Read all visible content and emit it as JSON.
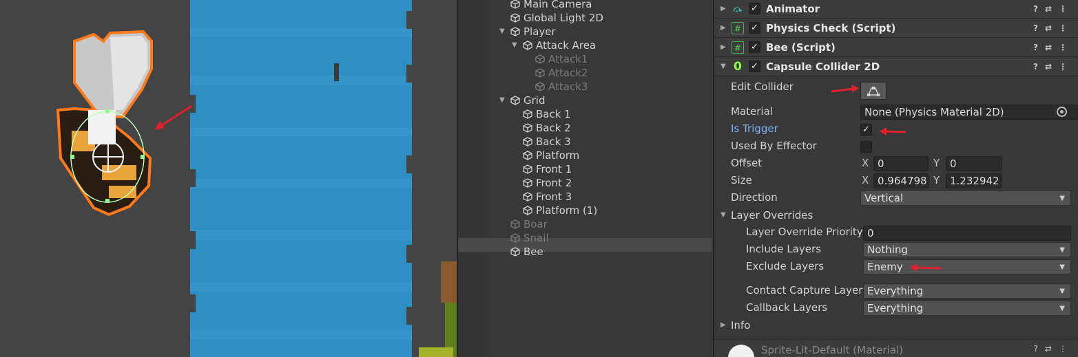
{
  "hierarchy": {
    "items": [
      {
        "label": "Main Camera",
        "depth": 1,
        "disabled": false,
        "expander": ""
      },
      {
        "label": "Global Light 2D",
        "depth": 1,
        "disabled": false,
        "expander": ""
      },
      {
        "label": "Player",
        "depth": 1,
        "disabled": false,
        "expander": "expanded"
      },
      {
        "label": "Attack Area",
        "depth": 2,
        "disabled": false,
        "expander": "expanded"
      },
      {
        "label": "Attack1",
        "depth": 3,
        "disabled": true,
        "expander": ""
      },
      {
        "label": "Attack2",
        "depth": 3,
        "disabled": true,
        "expander": ""
      },
      {
        "label": "Attack3",
        "depth": 3,
        "disabled": true,
        "expander": ""
      },
      {
        "label": "Grid",
        "depth": 1,
        "disabled": false,
        "expander": "expanded"
      },
      {
        "label": "Back 1",
        "depth": 2,
        "disabled": false,
        "expander": ""
      },
      {
        "label": "Back 2",
        "depth": 2,
        "disabled": false,
        "expander": ""
      },
      {
        "label": "Back 3",
        "depth": 2,
        "disabled": false,
        "expander": ""
      },
      {
        "label": "Platform",
        "depth": 2,
        "disabled": false,
        "expander": ""
      },
      {
        "label": "Front 1",
        "depth": 2,
        "disabled": false,
        "expander": ""
      },
      {
        "label": "Front 2",
        "depth": 2,
        "disabled": false,
        "expander": ""
      },
      {
        "label": "Front 3",
        "depth": 2,
        "disabled": false,
        "expander": ""
      },
      {
        "label": "Platform (1)",
        "depth": 2,
        "disabled": false,
        "expander": ""
      },
      {
        "label": "Boar",
        "depth": 1,
        "disabled": true,
        "expander": ""
      },
      {
        "label": "Snail",
        "depth": 1,
        "disabled": true,
        "expander": ""
      },
      {
        "label": "Bee",
        "depth": 1,
        "disabled": false,
        "expander": "",
        "selected": true
      }
    ]
  },
  "inspector": {
    "components": [
      {
        "name": "Animator",
        "icon": "animator-icon",
        "enabled": true
      },
      {
        "name": "Physics Check (Script)",
        "icon": "script-icon",
        "enabled": true
      },
      {
        "name": "Bee (Script)",
        "icon": "script-icon",
        "enabled": true
      },
      {
        "name": "Capsule Collider 2D",
        "icon": "capsule-collider-icon",
        "enabled": true
      }
    ],
    "collider": {
      "edit_collider_label": "Edit Collider",
      "material_label": "Material",
      "material_value": "None (Physics Material 2D)",
      "is_trigger_label": "Is Trigger",
      "is_trigger": true,
      "used_by_effector_label": "Used By Effector",
      "used_by_effector": false,
      "offset_label": "Offset",
      "offset_x": "0",
      "offset_y": "0",
      "size_label": "Size",
      "size_x": "0.964798",
      "size_y": "1.232942",
      "direction_label": "Direction",
      "direction_value": "Vertical",
      "layer_overrides_label": "Layer Overrides",
      "layer_override_priority_label": "Layer Override Priority",
      "layer_override_priority_value": "0",
      "include_layers_label": "Include Layers",
      "include_layers_value": "Nothing",
      "exclude_layers_label": "Exclude Layers",
      "exclude_layers_value": "Enemy",
      "contact_capture_layers_label": "Contact Capture Layers",
      "contact_capture_layers_value": "Everything",
      "callback_layers_label": "Callback Layers",
      "callback_layers_value": "Everything",
      "info_label": "Info",
      "x_axis": "X",
      "y_axis": "Y"
    },
    "material_footer": "Sprite-Lit-Default (Material)"
  },
  "colors": {
    "annotation_arrow": "#e0202a",
    "water": "#2d8fc3",
    "link_blue": "#7fb4ff",
    "collider_outline": "#b8ffb8",
    "bee_outline": "#ff7a1a"
  }
}
